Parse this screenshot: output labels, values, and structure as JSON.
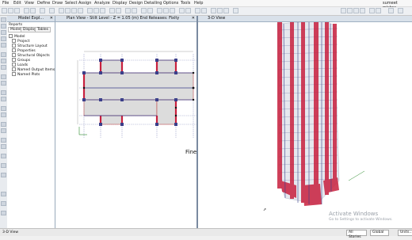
{
  "menu": [
    "File",
    "Edit",
    "View",
    "Define",
    "Draw",
    "Select",
    "Assign",
    "Analyze",
    "Display",
    "Design",
    "Detailing",
    "Options",
    "Tools",
    "Help"
  ],
  "user": "sumeet mishra",
  "explorer": {
    "title": "Model Expl...",
    "tabs": [
      "Model",
      "Display",
      "Tables"
    ],
    "reports_label": "Reports",
    "root": "Model",
    "items": [
      "Project",
      "Structure Layout",
      "Properties",
      "Structural Objects",
      "Groups",
      "Loads",
      "Named Output Items",
      "Named Plots"
    ]
  },
  "plan_view": {
    "title": "Plan View - Stilt Level - Z = 1.05 (m)  End Releases: Fixity",
    "mode_text": "Fine"
  },
  "view3d": {
    "title": "3-D View",
    "watermark_title": "Activate Windows",
    "watermark_sub": "Go to Settings to activate Windows."
  },
  "status": {
    "left": "3-D View",
    "story": "All Stories",
    "coord": "Global",
    "units": "Units..."
  },
  "colors": {
    "column_fill": "#c8203e",
    "slab_fill": "#dcdcdc",
    "beam": "#3b3f8a",
    "panel_title": "#d9e1ea"
  }
}
